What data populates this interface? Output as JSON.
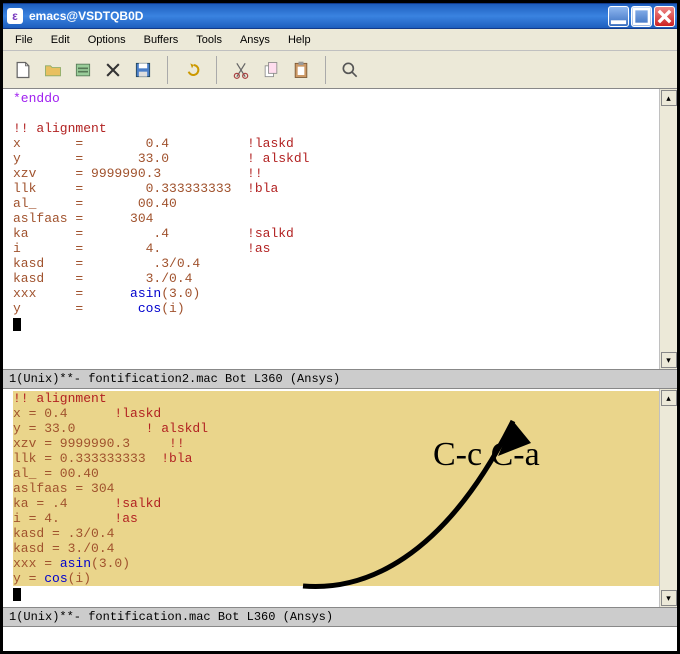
{
  "window": {
    "title": "emacs@VSDTQB0D"
  },
  "menu": {
    "file": "File",
    "edit": "Edit",
    "options": "Options",
    "buffers": "Buffers",
    "tools": "Tools",
    "ansys": "Ansys",
    "help": "Help"
  },
  "pane1": {
    "lines": {
      "l0": "*enddo",
      "l1": "",
      "l2": "!! alignment",
      "l3_a": "x       =        0.4          ",
      "l3_b": "!laskd",
      "l4_a": "y       =       33.0          ",
      "l4_b": "! alskdl",
      "l5_a": "xzv     = 9999990.3           ",
      "l5_b": "!!",
      "l6_a": "llk     =        0.333333333  ",
      "l6_b": "!bla",
      "l7": "al_     =       00.40",
      "l8": "aslfaas =      304",
      "l9_a": "ka      =         .4          ",
      "l9_b": "!salkd",
      "l10_a": "i       =        4.           ",
      "l10_b": "!as",
      "l11": "kasd    =         .3/0.4",
      "l12": "kasd    =        3./0.4",
      "l13_a": "xxx     =      ",
      "l13_b": "asin",
      "l13_c": "(3.0)",
      "l14_a": "y       =       ",
      "l14_b": "cos",
      "l14_c": "(i)"
    },
    "modeline": "1(Unix)**-  fontification2.mac   Bot L360   (Ansys)"
  },
  "pane2": {
    "lines": {
      "l0": "!! alignment",
      "l1_a": "x = 0.4      ",
      "l1_b": "!laskd",
      "l2_a": "y = 33.0         ",
      "l2_b": "! alskdl",
      "l3_a": "xzv = 9999990.3     ",
      "l3_b": "!!",
      "l4_a": "llk = 0.333333333  ",
      "l4_b": "!bla",
      "l5": "al_ = 00.40",
      "l6": "aslfaas = 304",
      "l7_a": "ka = .4      ",
      "l7_b": "!salkd",
      "l8_a": "i = 4.       ",
      "l8_b": "!as",
      "l9": "kasd = .3/0.4",
      "l10": "kasd = 3./0.4",
      "l11_a": "xxx = ",
      "l11_b": "asin",
      "l11_c": "(3.0)",
      "l12_a": "y = ",
      "l12_b": "cos",
      "l12_c": "(i)"
    },
    "modeline": "1(Unix)**-  fontification.mac   Bot L360   (Ansys)"
  },
  "annotation": {
    "label": "C-c C-a"
  }
}
